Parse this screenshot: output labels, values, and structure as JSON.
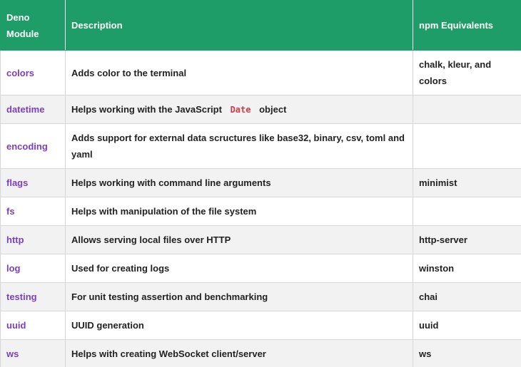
{
  "table": {
    "headers": {
      "module": "Deno Module",
      "description": "Description",
      "npm": "npm Equivalents"
    },
    "rows": [
      {
        "module": "colors",
        "description": "Adds color to the terminal",
        "npm": "chalk, kleur, and colors"
      },
      {
        "module": "datetime",
        "description_before": "Helps working with the JavaScript",
        "description_code": "Date",
        "description_after": "object",
        "npm": ""
      },
      {
        "module": "encoding",
        "description": "Adds support for external data scructures like base32, binary, csv, toml and yaml",
        "npm": ""
      },
      {
        "module": "flags",
        "description": "Helps working with command line arguments",
        "npm": "minimist"
      },
      {
        "module": "fs",
        "description": "Helps with manipulation of the file system",
        "npm": ""
      },
      {
        "module": "http",
        "description": "Allows serving local files over HTTP",
        "npm": "http-server"
      },
      {
        "module": "log",
        "description": "Used for creating logs",
        "npm": "winston"
      },
      {
        "module": "testing",
        "description": "For unit testing assertion and benchmarking",
        "npm": "chai"
      },
      {
        "module": "uuid",
        "description": "UUID generation",
        "npm": "uuid"
      },
      {
        "module": "ws",
        "description": "Helps with creating WebSocket client/server",
        "npm": "ws"
      }
    ]
  },
  "colors": {
    "header_bg": "#1f9d68",
    "module_text": "#7a40bd",
    "code_text": "#d33a4a",
    "alt_row_bg": "#f2f2f2"
  }
}
